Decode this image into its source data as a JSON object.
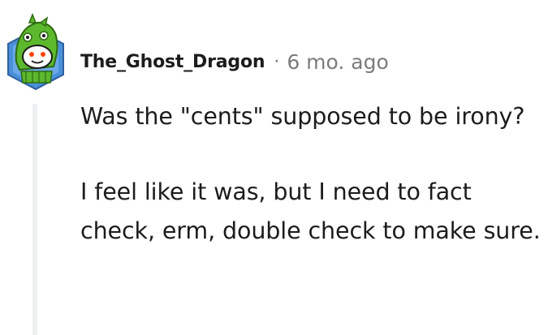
{
  "comment": {
    "author": {
      "username": "The_Ghost_Dragon",
      "avatar_icon": "dragon-avatar-icon"
    },
    "separator": "·",
    "timestamp": "6 mo. ago",
    "paragraphs": [
      "Was the \"cents\" supposed to be irony?",
      "I feel like it was, but I need to fact check, erm, double check to make sure."
    ]
  },
  "colors": {
    "text": "#1c1c1c",
    "meta": "#7c7c7c",
    "thread_line": "#edeff1",
    "avatar_bg": "#3f87d9",
    "dragon_green": "#5cb82c"
  }
}
